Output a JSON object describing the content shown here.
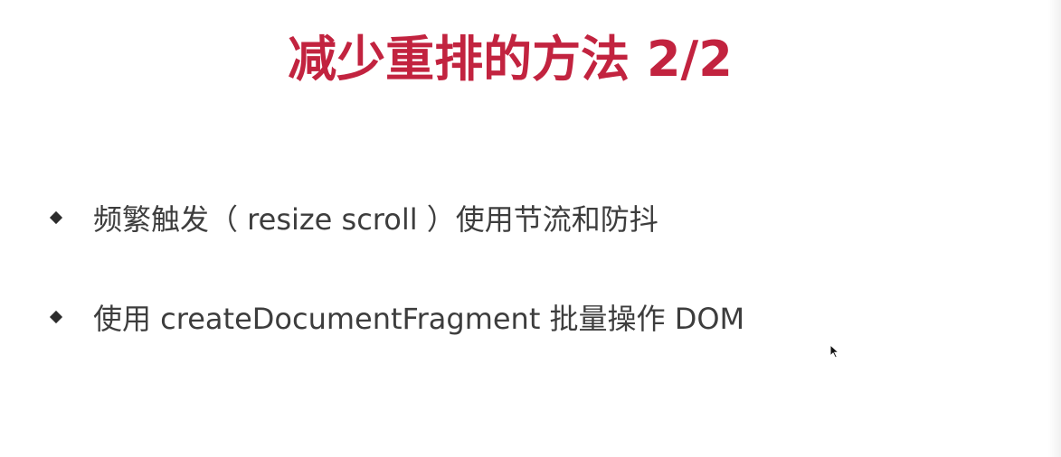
{
  "slide": {
    "title": "减少重排的方法 2/2",
    "bullets": [
      "频繁触发（ resize scroll ）使用节流和防抖",
      "使用 createDocumentFragment 批量操作 DOM"
    ]
  },
  "colors": {
    "title": "#c2233f",
    "text": "#3d3d3d",
    "bullet_marker": "#2c2c2c",
    "background": "#ffffff"
  },
  "icons": {
    "bullet": "diamond-bullet-icon",
    "pointer": "mouse-pointer-icon"
  }
}
